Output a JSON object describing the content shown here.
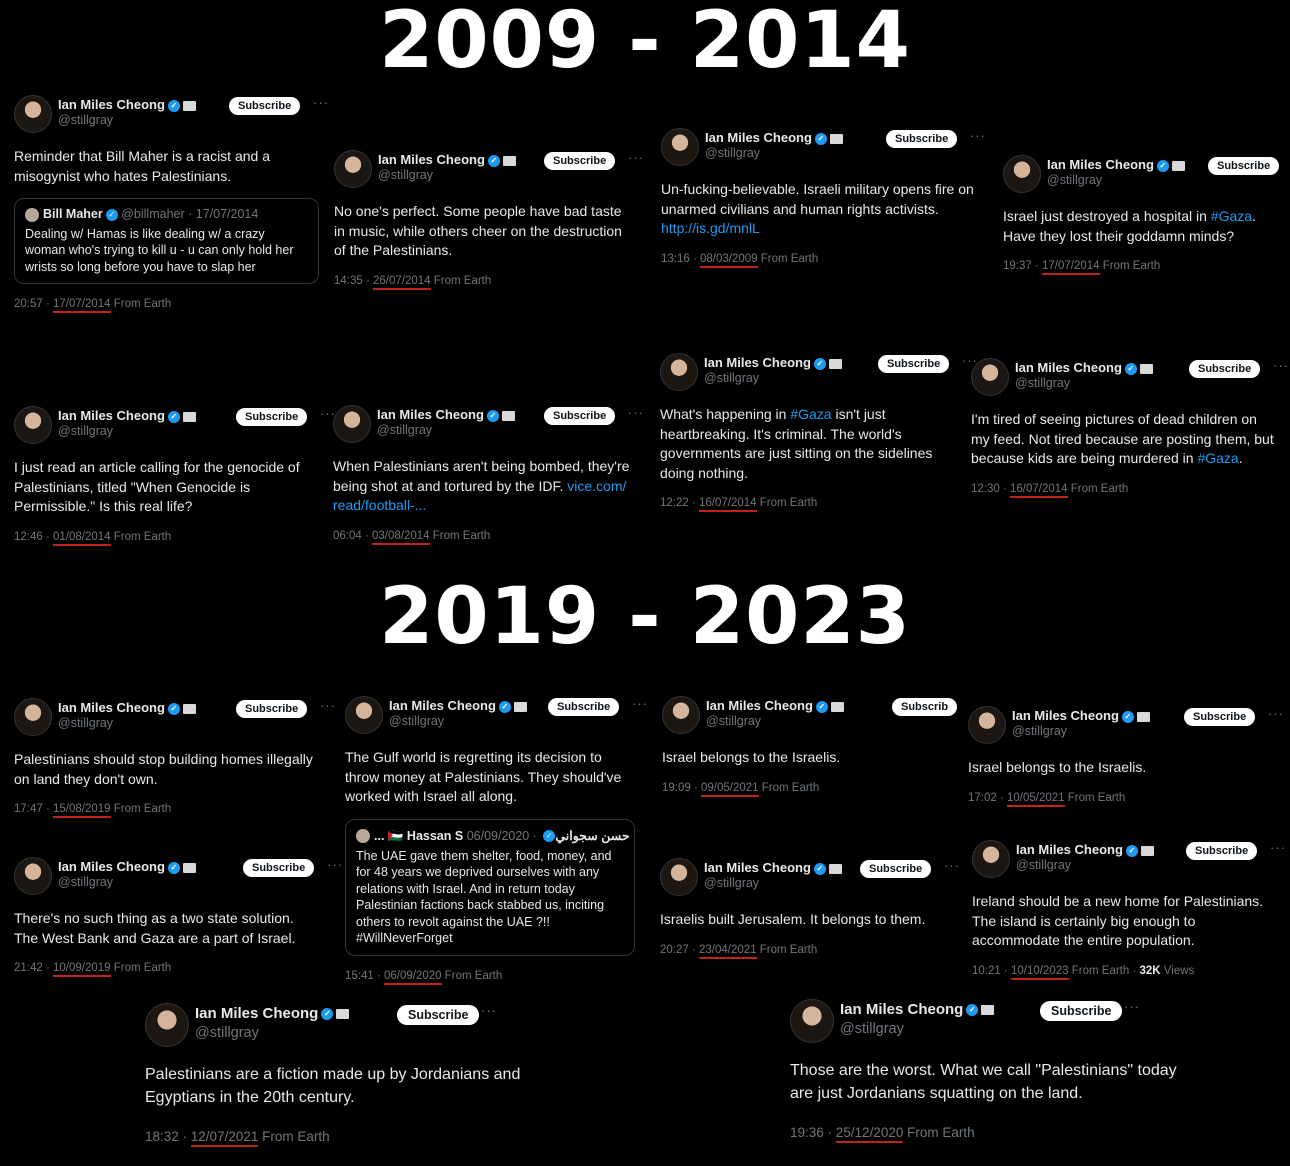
{
  "headings": {
    "top": "2009 - 2014",
    "bottom": "2019 - 2023"
  },
  "author": {
    "name": "Ian Miles Cheong",
    "handle": "@stillgray",
    "subscribe": "Subscribe",
    "more": "···",
    "verified_icon": "verified-badge-icon",
    "accent": "#1d9bf0"
  },
  "tweets": [
    {
      "text": "Reminder that Bill Maher is a racist and a misogynist who hates Palestinians.",
      "time": "20:57 · ",
      "date": "17/07/2014",
      "source": " From Earth",
      "quote": {
        "name": "Bill Maher",
        "meta": "@billmaher · 17/07/2014",
        "text": "Dealing w/ Hamas is like dealing w/ a crazy woman who's trying to kill u - u can only hold her wrists so long before you have to slap her"
      }
    },
    {
      "text": "No one's perfect. Some people have bad taste in music, while others cheer on the destruction of the Palestinians.",
      "time": "14:35 · ",
      "date": "26/07/2014",
      "source": " From Earth"
    },
    {
      "text": "Un-fucking-believable. Israeli military opens fire on unarmed civilians and human rights activists.",
      "link": "http://is.gd/mnlL",
      "time": "13:16 · ",
      "date": "08/03/2009",
      "source": " From Earth"
    },
    {
      "text_a": "Israel just destroyed a hospital in ",
      "hashtag": "#Gaza",
      "text_b": ". Have they lost their goddamn minds?",
      "time": "19:37 · ",
      "date": "17/07/2014",
      "source": " From Earth"
    },
    {
      "text": "I just read an article calling for the genocide of Palestinians, titled \"When Genocide is Permissible.\" Is this real life?",
      "time": "12:46 · ",
      "date": "01/08/2014",
      "source": " From Earth"
    },
    {
      "text": "When Palestinians aren't being bombed, they're being shot at and tortured by the IDF.",
      "link": "vice.com/ read/football-...",
      "time": "06:04 · ",
      "date": "03/08/2014",
      "source": " From Earth"
    },
    {
      "text_a": "What's happening in ",
      "hashtag": "#Gaza",
      "text_b": " isn't just heartbreaking. It's criminal. The world's governments are just sitting on the sidelines doing nothing.",
      "time": "12:22 · ",
      "date": "16/07/2014",
      "source": " From Earth"
    },
    {
      "text_a": "I'm tired of seeing pictures of dead children on my feed. Not tired because are posting them, but because kids are being murdered in ",
      "hashtag": "#Gaza",
      "text_b": ".",
      "time": "12:30 · ",
      "date": "16/07/2014",
      "source": " From Earth"
    },
    {
      "text": "Palestinians should stop building homes illegally on land they don't own.",
      "time": "17:47 · ",
      "date": "15/08/2019",
      "source": " From Earth"
    },
    {
      "text": "The Gulf world is regretting its decision to throw money at Palestinians. They should've worked with Israel all along.",
      "time": "15:41 · ",
      "date": "06/09/2020",
      "source": " From Earth",
      "quote": {
        "name": "... 🇵🇸 Hassan S حسن سجواني",
        "meta": "· 06/09/2020",
        "text": "The UAE gave them shelter, food, money, and for 48 years we deprived ourselves with any relations with Israel. And in return today Palestinian factions back stabbed us, inciting others to revolt against the UAE ?!! #WillNeverForget"
      }
    },
    {
      "text": "Israel belongs to the Israelis.",
      "time": "19:09 · ",
      "date": "09/05/2021",
      "source": " From Earth",
      "subscribe": "Subscrib"
    },
    {
      "text": "Israel belongs to the Israelis.",
      "time": "17:02 · ",
      "date": "10/05/2021",
      "source": " From Earth"
    },
    {
      "text": "There's no such thing as a two state solution. The West Bank and Gaza are a part of Israel.",
      "time": "21:42 · ",
      "date": "10/09/2019",
      "source": " From Earth"
    },
    {
      "text": "Israelis built Jerusalem. It belongs to them.",
      "time": "20:27 · ",
      "date": "23/04/2021",
      "source": " From Earth"
    },
    {
      "text": "Ireland should be a new home for Palestinians. The island is certainly big enough to accommodate the entire population.",
      "time": "10:21 · ",
      "date": "10/10/2023",
      "source": " From Earth · ",
      "views_count": "32K",
      "views_label": " Views"
    },
    {
      "text": "Palestinians are a fiction made up by Jordanians and Egyptians in the 20th century.",
      "time": "18:32 · ",
      "date": "12/07/2021",
      "source": " From Earth"
    },
    {
      "text": "Those are the worst. What we call \"Palestinians\" today are just Jordanians squatting on the land.",
      "time": "19:36 · ",
      "date": "25/12/2020",
      "source": " From Earth"
    }
  ]
}
